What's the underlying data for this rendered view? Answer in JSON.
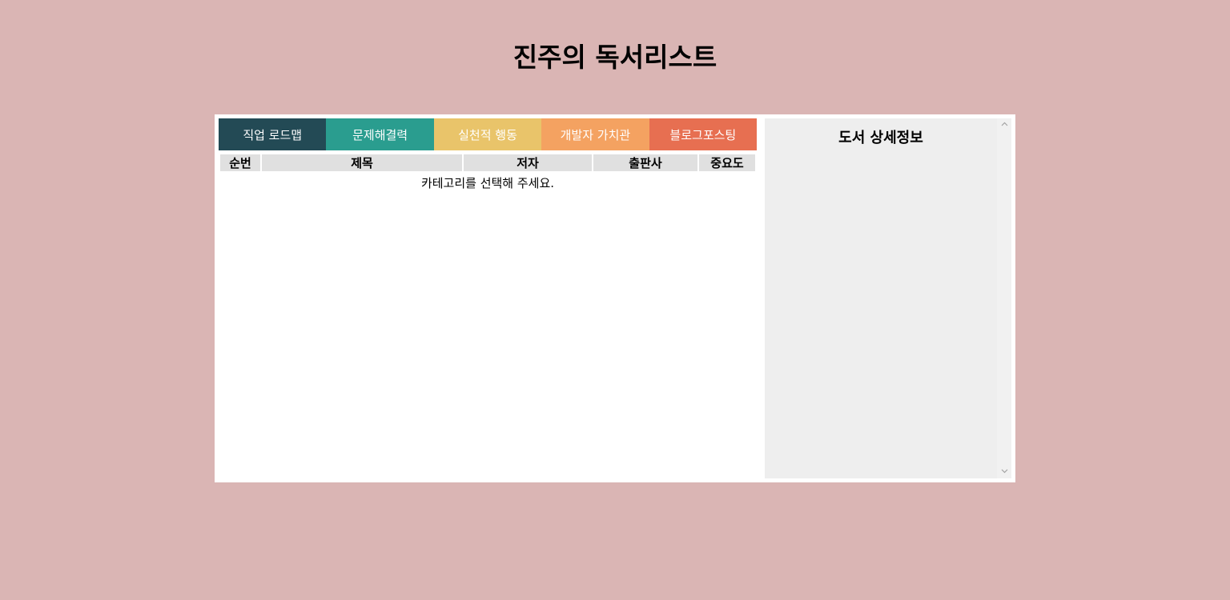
{
  "header": {
    "title": "진주의 독서리스트"
  },
  "tabs": [
    {
      "label": "직업 로드맵",
      "color": "#234a55"
    },
    {
      "label": "문제해결력",
      "color": "#2a9d8f"
    },
    {
      "label": "실천적 행동",
      "color": "#e9c46a"
    },
    {
      "label": "개발자 가치관",
      "color": "#f4a261"
    },
    {
      "label": "블로그포스팅",
      "color": "#e76f51"
    }
  ],
  "table": {
    "columns": [
      "순번",
      "제목",
      "저자",
      "출판사",
      "중요도"
    ],
    "empty_message": "카테고리를 선택해 주세요."
  },
  "detail": {
    "title": "도서 상세정보"
  },
  "colors": {
    "background": "#dab5b4",
    "panel": "#ffffff",
    "detail_bg": "#eeeeee",
    "header_cell": "#e0e0e0"
  },
  "icons": {
    "scroll_up": "chevron-up-icon",
    "scroll_down": "chevron-down-icon"
  }
}
